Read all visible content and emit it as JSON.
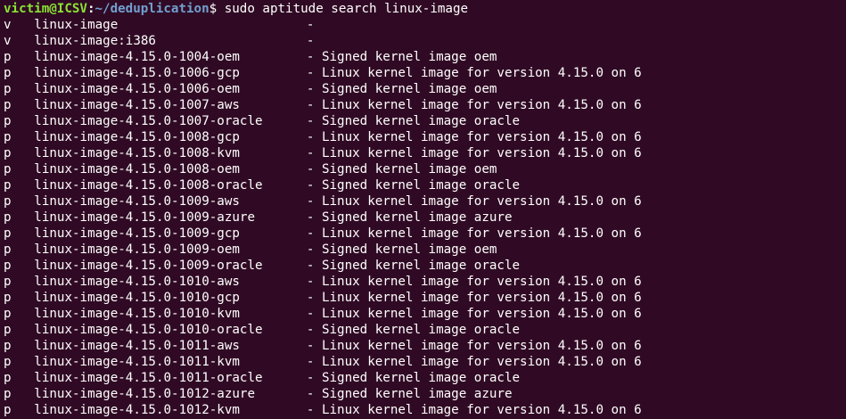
{
  "prompt": {
    "user_host": "victim@ICSV",
    "colon": ":",
    "path": "~/deduplication",
    "symbol": "$",
    "command": " sudo aptitude search linux-image"
  },
  "results": [
    {
      "state": "v",
      "name": "linux-image",
      "desc": "-"
    },
    {
      "state": "v",
      "name": "linux-image:i386",
      "desc": "-"
    },
    {
      "state": "p",
      "name": "linux-image-4.15.0-1004-oem",
      "desc": "- Signed kernel image oem"
    },
    {
      "state": "p",
      "name": "linux-image-4.15.0-1006-gcp",
      "desc": "- Linux kernel image for version 4.15.0 on 6"
    },
    {
      "state": "p",
      "name": "linux-image-4.15.0-1006-oem",
      "desc": "- Signed kernel image oem"
    },
    {
      "state": "p",
      "name": "linux-image-4.15.0-1007-aws",
      "desc": "- Linux kernel image for version 4.15.0 on 6"
    },
    {
      "state": "p",
      "name": "linux-image-4.15.0-1007-oracle",
      "desc": "- Signed kernel image oracle"
    },
    {
      "state": "p",
      "name": "linux-image-4.15.0-1008-gcp",
      "desc": "- Linux kernel image for version 4.15.0 on 6"
    },
    {
      "state": "p",
      "name": "linux-image-4.15.0-1008-kvm",
      "desc": "- Linux kernel image for version 4.15.0 on 6"
    },
    {
      "state": "p",
      "name": "linux-image-4.15.0-1008-oem",
      "desc": "- Signed kernel image oem"
    },
    {
      "state": "p",
      "name": "linux-image-4.15.0-1008-oracle",
      "desc": "- Signed kernel image oracle"
    },
    {
      "state": "p",
      "name": "linux-image-4.15.0-1009-aws",
      "desc": "- Linux kernel image for version 4.15.0 on 6"
    },
    {
      "state": "p",
      "name": "linux-image-4.15.0-1009-azure",
      "desc": "- Signed kernel image azure"
    },
    {
      "state": "p",
      "name": "linux-image-4.15.0-1009-gcp",
      "desc": "- Linux kernel image for version 4.15.0 on 6"
    },
    {
      "state": "p",
      "name": "linux-image-4.15.0-1009-oem",
      "desc": "- Signed kernel image oem"
    },
    {
      "state": "p",
      "name": "linux-image-4.15.0-1009-oracle",
      "desc": "- Signed kernel image oracle"
    },
    {
      "state": "p",
      "name": "linux-image-4.15.0-1010-aws",
      "desc": "- Linux kernel image for version 4.15.0 on 6"
    },
    {
      "state": "p",
      "name": "linux-image-4.15.0-1010-gcp",
      "desc": "- Linux kernel image for version 4.15.0 on 6"
    },
    {
      "state": "p",
      "name": "linux-image-4.15.0-1010-kvm",
      "desc": "- Linux kernel image for version 4.15.0 on 6"
    },
    {
      "state": "p",
      "name": "linux-image-4.15.0-1010-oracle",
      "desc": "- Signed kernel image oracle"
    },
    {
      "state": "p",
      "name": "linux-image-4.15.0-1011-aws",
      "desc": "- Linux kernel image for version 4.15.0 on 6"
    },
    {
      "state": "p",
      "name": "linux-image-4.15.0-1011-kvm",
      "desc": "- Linux kernel image for version 4.15.0 on 6"
    },
    {
      "state": "p",
      "name": "linux-image-4.15.0-1011-oracle",
      "desc": "- Signed kernel image oracle"
    },
    {
      "state": "p",
      "name": "linux-image-4.15.0-1012-azure",
      "desc": "- Signed kernel image azure"
    },
    {
      "state": "p",
      "name": "linux-image-4.15.0-1012-kvm",
      "desc": "- Linux kernel image for version 4.15.0 on 6"
    }
  ]
}
